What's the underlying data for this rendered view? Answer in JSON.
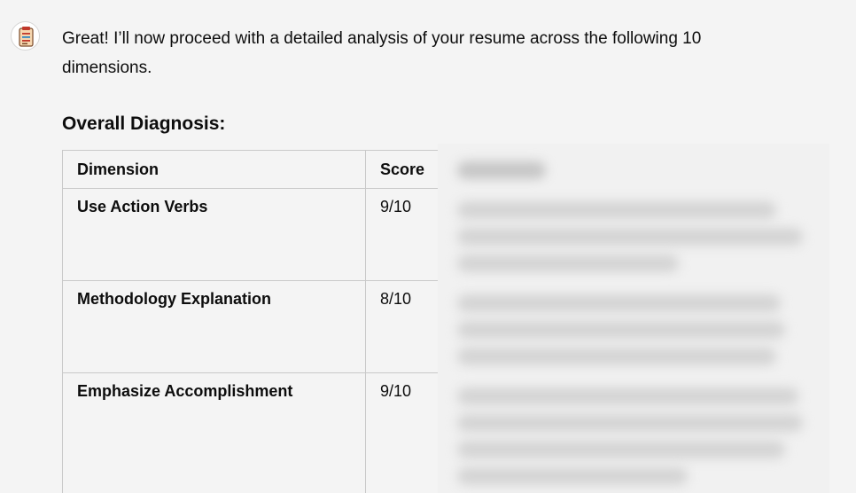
{
  "assistant": {
    "avatar_icon": "clipboard-checklist-icon",
    "message": "Great! I’ll now proceed with a detailed analysis of your resume across the following 10 dimensions."
  },
  "section": {
    "heading": "Overall Diagnosis:"
  },
  "table": {
    "headers": [
      "Dimension",
      "Score"
    ],
    "rows": [
      {
        "dimension": "Use Action Verbs",
        "score": "9/10"
      },
      {
        "dimension": "Methodology Explanation",
        "score": "8/10"
      },
      {
        "dimension": "Emphasize Accomplishment",
        "score": "9/10"
      }
    ]
  },
  "colors": {
    "background": "#f4f4f4",
    "text": "#0d0d0d",
    "border": "#c9c9c9"
  }
}
